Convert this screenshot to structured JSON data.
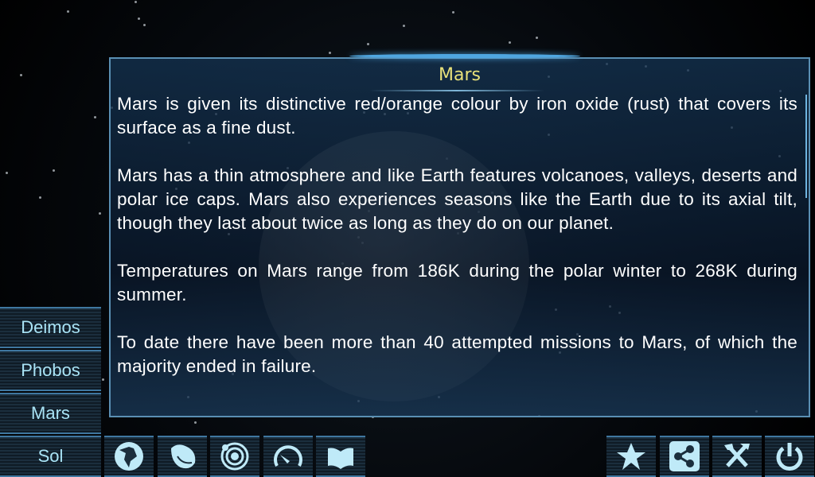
{
  "panel": {
    "title": "Mars",
    "paragraphs": [
      "Mars is given its distinctive red/orange colour by iron oxide (rust) that covers its surface as a fine dust.",
      "Mars has a thin atmosphere and like Earth features volcanoes, valleys, deserts and polar ice caps. Mars also experiences seasons like the Earth due to its axial tilt, though they last about twice as long as they do on our planet.",
      "Temperatures on Mars range from 186K during the polar winter to 268K during summer.",
      "To date there have been more than 40 attempted missions to Mars, of which the majority ended in failure."
    ]
  },
  "sidebar": {
    "items": [
      {
        "label": "Deimos"
      },
      {
        "label": "Phobos"
      },
      {
        "label": "Mars"
      },
      {
        "label": "Sol"
      }
    ]
  },
  "toolbar_left": [
    "globe-icon",
    "asteroid-icon",
    "orbit-icon",
    "speedometer-icon",
    "book-icon"
  ],
  "toolbar_right": [
    "star-icon",
    "share-icon",
    "tools-icon",
    "power-icon"
  ],
  "colors": {
    "title": "#e9e27a",
    "button_text": "#a9e3f5",
    "accent": "#4fa6e0"
  }
}
